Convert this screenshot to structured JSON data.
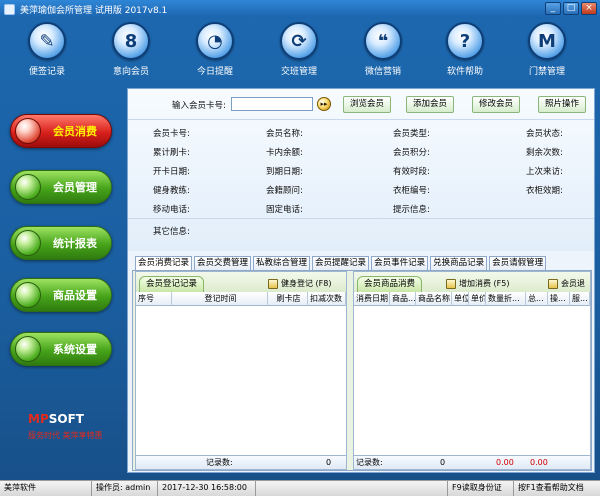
{
  "window": {
    "title": "美萍瑜伽会所管理 试用版 2017v8.1",
    "min": "_",
    "max": "□",
    "close": "×"
  },
  "toolbar": [
    {
      "label": "便签记录",
      "glyph": "✎"
    },
    {
      "label": "意向会员",
      "glyph": "8"
    },
    {
      "label": "今日提醒",
      "glyph": "◔"
    },
    {
      "label": "交班管理",
      "glyph": "⟳"
    },
    {
      "label": "微信营销",
      "glyph": "❝"
    },
    {
      "label": "软件帮助",
      "glyph": "?"
    },
    {
      "label": "门禁管理",
      "glyph": "M"
    }
  ],
  "nav": [
    {
      "label": "会员消费",
      "active": true
    },
    {
      "label": "会员管理"
    },
    {
      "label": "统计报表"
    },
    {
      "label": "商品设置"
    },
    {
      "label": "系统设置"
    }
  ],
  "brand": {
    "logo_mp": "MP",
    "logo_rest": "SOFT",
    "slogan": "服务时代 美萍享特惠"
  },
  "search": {
    "label": "输入会员卡号:",
    "value": "",
    "go_glyph": "▸▸",
    "buttons": [
      "浏览会员",
      "添加会员",
      "修改会员",
      "照片操作"
    ]
  },
  "info_fields": [
    {
      "label": "会员卡号:"
    },
    {
      "label": "会员名称:"
    },
    {
      "label": "会员类型:"
    },
    {
      "label": "会员状态:"
    },
    {
      "label": "累计刷卡:"
    },
    {
      "label": "卡内余额:"
    },
    {
      "label": "会员积分:"
    },
    {
      "label": "剩余次数:"
    },
    {
      "label": "开卡日期:"
    },
    {
      "label": "到期日期:"
    },
    {
      "label": "有效时段:"
    },
    {
      "label": "上次来访:"
    },
    {
      "label": "健身教练:"
    },
    {
      "label": "会籍顾问:"
    },
    {
      "label": "衣柜编号:"
    },
    {
      "label": "衣柜效期:"
    },
    {
      "label": "移动电话:"
    },
    {
      "label": "固定电话:"
    },
    {
      "label": "提示信息:"
    }
  ],
  "other_info_label": "其它信息:",
  "tabs": [
    "会员消费记录",
    "会员交费管理",
    "私教综合管理",
    "会员提醒记录",
    "会员事件记录",
    "兑换商品记录",
    "会员请假管理"
  ],
  "left_panel": {
    "tab": "会员登记记录",
    "button": "健身登记 (F8)",
    "columns": [
      "序号",
      "登记时间",
      "刷卡店",
      "扣减次数"
    ],
    "footer_label": "记录数:",
    "footer_value": "0"
  },
  "right_panel": {
    "tab": "会员商品消费",
    "button1": "增加消费 (F5)",
    "button2": "会员退",
    "columns": [
      "消费日期",
      "商品...",
      "商品名称",
      "单位",
      "单价",
      "数量折...",
      "总...",
      "操...",
      "服..."
    ],
    "footer_label": "记录数:",
    "footer_value": "0",
    "footer_total1": "0.00",
    "footer_total2": "0.00"
  },
  "status": {
    "company": "美萍软件",
    "operator": "操作员: admin",
    "datetime": "2017-12-30 16:58:00",
    "idcard": "F9读取身份证",
    "help": "按F1查看帮助文档"
  }
}
